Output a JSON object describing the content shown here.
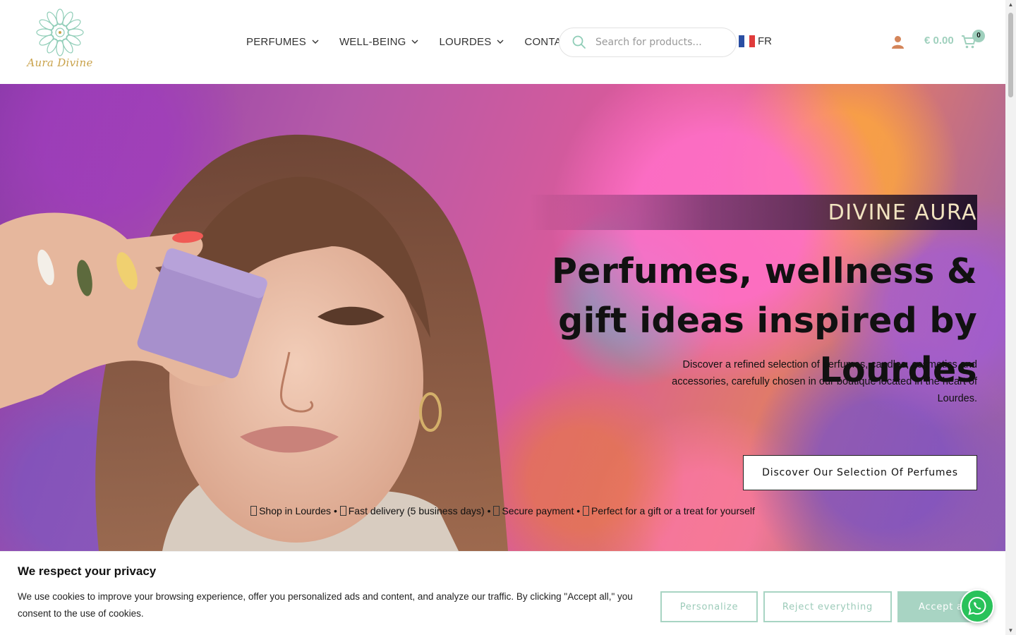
{
  "header": {
    "logo_text": "Aura Divine",
    "nav": [
      {
        "label": "PERFUMES",
        "has_dropdown": true
      },
      {
        "label": "WELL-BEING",
        "has_dropdown": true
      },
      {
        "label": "LOURDES",
        "has_dropdown": true
      },
      {
        "label": "CONTACT",
        "has_dropdown": false
      }
    ],
    "search": {
      "placeholder": "Search for products..."
    },
    "language": {
      "label": "FR",
      "flag": "france-flag"
    },
    "account_icon": "user-icon",
    "cart": {
      "total": "€ 0.00",
      "count": "0",
      "icon": "cart-icon"
    }
  },
  "hero": {
    "tagline": "DIVINE AURA",
    "headline": "Perfumes, wellness & gift ideas inspired by Lourdes",
    "lead": "Discover a refined selection of perfumes, candles, cosmetics and accessories, carefully chosen in our boutique located in the heart of Lourdes.",
    "cta_label": "Discover Our Selection Of Perfumes",
    "features": [
      "Shop in Lourdes",
      "Fast delivery (5 business days)",
      "Secure payment",
      "Perfect for a gift or a treat for yourself"
    ],
    "feature_separator": "•"
  },
  "cookie": {
    "title": "We respect your privacy",
    "text": "We use cookies to improve your browsing experience, offer you personalized ads and content, and analyze our traffic. By clicking \"Accept all,\" you consent to the use of cookies.",
    "personalize": "Personalize",
    "reject": "Reject everything",
    "accept": "Accept all"
  },
  "colors": {
    "accent": "#9fd0bd",
    "accent_button": "#a8d4c3",
    "logo_gold": "#c9a24a",
    "tagline": "#f1e3c0",
    "whatsapp": "#29c25a"
  }
}
